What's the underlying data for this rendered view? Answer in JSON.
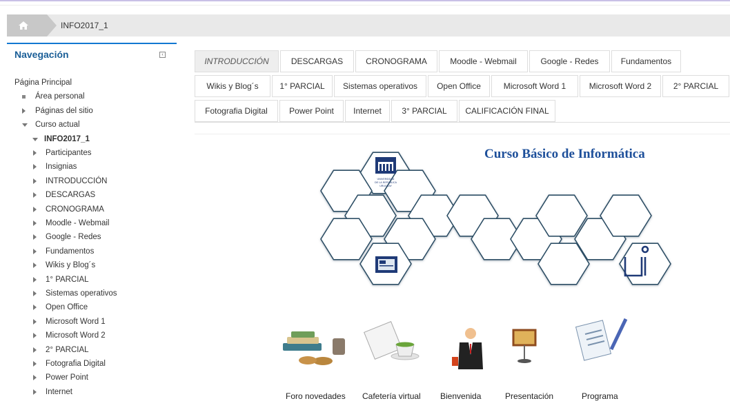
{
  "breadcrumb": {
    "home_icon": "home-icon",
    "item": "INFO2017_1"
  },
  "navigation": {
    "title": "Navegación",
    "dock_icon": "dock-icon",
    "rows": [
      {
        "label": "Página Principal",
        "icon": "none",
        "level": 0
      },
      {
        "label": "Área personal",
        "icon": "square",
        "level": 1
      },
      {
        "label": "Páginas del sitio",
        "icon": "collapsed",
        "level": 1
      },
      {
        "label": "Curso actual",
        "icon": "expanded",
        "level": 1
      },
      {
        "label": "INFO2017_1",
        "icon": "expanded",
        "level": 2,
        "bold": true
      },
      {
        "label": "Participantes",
        "icon": "collapsed",
        "level": 3
      },
      {
        "label": "Insignias",
        "icon": "collapsed",
        "level": 3
      },
      {
        "label": "INTRODUCCIÓN",
        "icon": "collapsed",
        "level": 3
      },
      {
        "label": "DESCARGAS",
        "icon": "collapsed",
        "level": 3
      },
      {
        "label": "CRONOGRAMA",
        "icon": "collapsed",
        "level": 3
      },
      {
        "label": "Moodle - Webmail",
        "icon": "collapsed",
        "level": 3
      },
      {
        "label": "Google - Redes",
        "icon": "collapsed",
        "level": 3
      },
      {
        "label": "Fundamentos",
        "icon": "collapsed",
        "level": 3
      },
      {
        "label": "Wikis y Blog´s",
        "icon": "collapsed",
        "level": 3
      },
      {
        "label": "1° PARCIAL",
        "icon": "collapsed",
        "level": 3
      },
      {
        "label": "Sistemas operativos",
        "icon": "collapsed",
        "level": 3
      },
      {
        "label": "Open Office",
        "icon": "collapsed",
        "level": 3
      },
      {
        "label": "Microsoft Word 1",
        "icon": "collapsed",
        "level": 3
      },
      {
        "label": "Microsoft Word 2",
        "icon": "collapsed",
        "level": 3
      },
      {
        "label": "2° PARCIAL",
        "icon": "collapsed",
        "level": 3
      },
      {
        "label": "Fotografia Digital",
        "icon": "collapsed",
        "level": 3
      },
      {
        "label": "Power Point",
        "icon": "collapsed",
        "level": 3
      },
      {
        "label": "Internet",
        "icon": "collapsed",
        "level": 3
      }
    ]
  },
  "tabs": [
    [
      {
        "label": "INTRODUCCIÓN",
        "active": true
      },
      {
        "label": "DESCARGAS"
      },
      {
        "label": "CRONOGRAMA"
      },
      {
        "label": "Moodle - Webmail"
      },
      {
        "label": "Google - Redes"
      },
      {
        "label": "Fundamentos"
      }
    ],
    [
      {
        "label": "Wikis y Blog´s"
      },
      {
        "label": "1° PARCIAL"
      },
      {
        "label": "Sistemas operativos"
      },
      {
        "label": "Open Office"
      },
      {
        "label": "Microsoft Word 1"
      },
      {
        "label": "Microsoft Word 2"
      },
      {
        "label": "2° PARCIAL"
      }
    ],
    [
      {
        "label": "Fotografia Digital"
      },
      {
        "label": "Power Point"
      },
      {
        "label": "Internet"
      },
      {
        "label": "3° PARCIAL"
      },
      {
        "label": "CALIFICACIÓN FINAL"
      }
    ]
  ],
  "banner": {
    "title": "Curso Básico de Informática",
    "logo_text": "UNIVERSIDAD DE LA REPÚBLICA URUGUAY"
  },
  "links": [
    {
      "label": "Foro novedades",
      "icon": "books-coffee-icon"
    },
    {
      "label": "Cafetería virtual",
      "icon": "newspaper-coffee-icon"
    },
    {
      "label": "Bienvenida",
      "icon": "businessman-icon"
    },
    {
      "label": "Presentación",
      "icon": "presentation-board-icon"
    },
    {
      "label": "Programa",
      "icon": "document-pencil-icon"
    }
  ],
  "colors": {
    "accent": "#1177d1",
    "nav_title": "#1a5e97",
    "banner_title": "#1d4f9a",
    "tab_active_bg": "#eeeeee"
  }
}
